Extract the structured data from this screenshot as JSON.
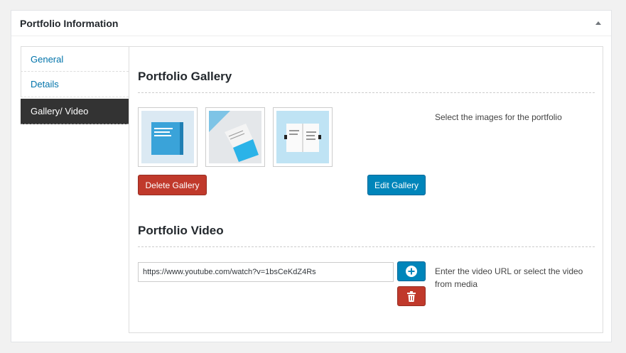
{
  "metabox": {
    "title": "Portfolio Information"
  },
  "tabs": [
    {
      "label": "General"
    },
    {
      "label": "Details"
    },
    {
      "label": "Gallery/ Video"
    }
  ],
  "gallery": {
    "title": "Portfolio Gallery",
    "help": "Select the images for the portfolio",
    "delete_label": "Delete Gallery",
    "edit_label": "Edit Gallery"
  },
  "video": {
    "title": "Portfolio Video",
    "url_value": "https://www.youtube.com/watch?v=1bsCeKdZ4Rs",
    "help": "Enter the video URL or select the video from media"
  },
  "colors": {
    "accent_blue": "#0085ba",
    "danger_red": "#c0392b",
    "active_tab": "#333333",
    "link": "#0073aa"
  }
}
